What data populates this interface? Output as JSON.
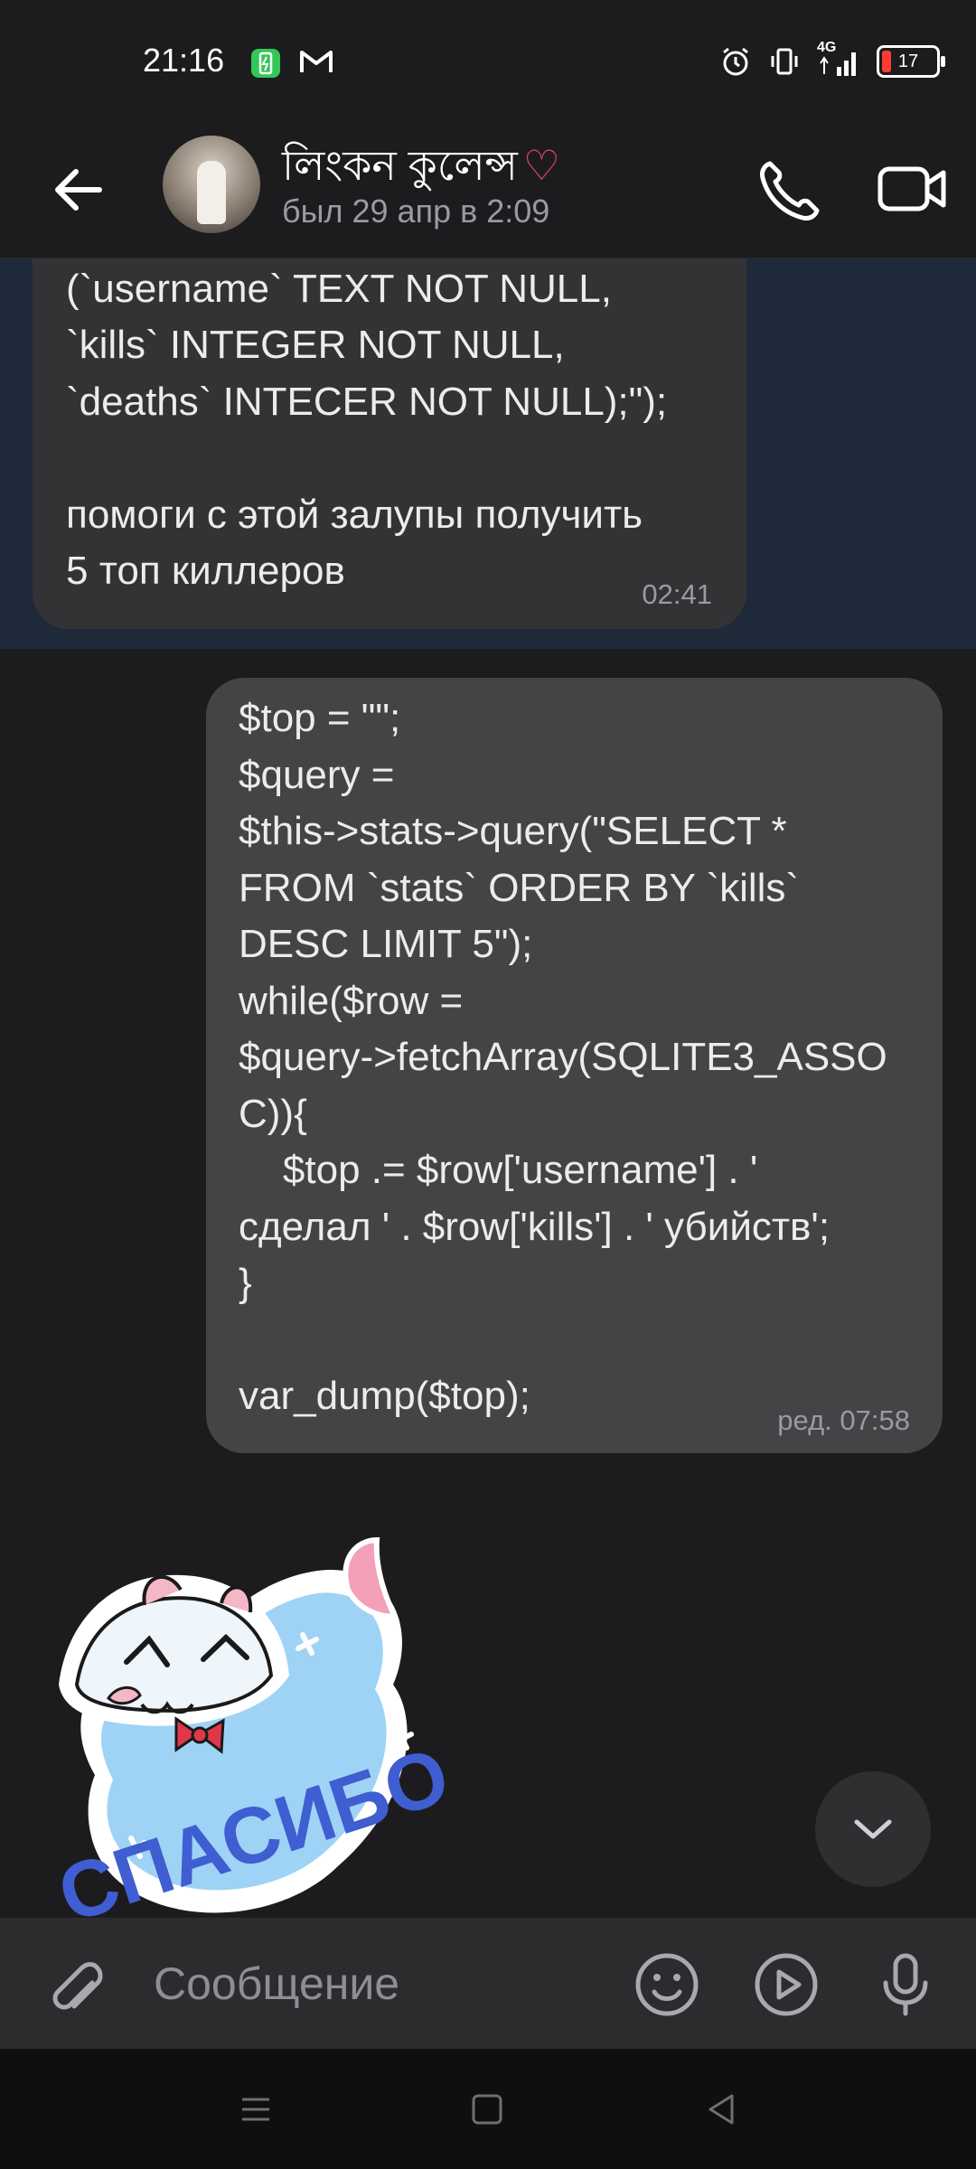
{
  "status_bar": {
    "time": "21:16",
    "network": "4G",
    "battery": "17"
  },
  "header": {
    "contact_name": "লিংকন কুলেন্স",
    "contact_name_emoji": "♡",
    "last_seen": "был 29 апр в 2:09"
  },
  "messages": [
    {
      "direction": "incoming",
      "text": "TABLE IF NOT EXISTS `stats`\n(`username` TEXT NOT NULL,\n`kills` INTEGER NOT NULL,\n`deaths` INTECER NOT NULL);\");\n\nпомоги с этой залупы получить\n5 топ киллеров",
      "time": "02:41"
    },
    {
      "direction": "outgoing",
      "text": "$top = \"\";\n$query =\n$this->stats->query(\"SELECT *\nFROM `stats` ORDER BY `kills`\nDESC LIMIT 5\");\nwhile($row =\n$query->fetchArray(SQLITE3_ASSO\nC)){\n    $top .= $row['username'] . '\nсделал ' . $row['kills'] . ' убийств';\n}\n\nvar_dump($top);",
      "time": "ред. 07:58"
    },
    {
      "direction": "incoming",
      "type": "sticker",
      "sticker_text": "СПАСИБО"
    }
  ],
  "input": {
    "placeholder": "Сообщение"
  },
  "icons": {
    "back": "arrow-left-icon",
    "call": "phone-icon",
    "video": "video-camera-icon",
    "attach": "paperclip-icon",
    "emoji": "smiley-icon",
    "video_message": "play-circle-icon",
    "voice": "microphone-icon",
    "scroll_down": "chevron-down-icon"
  },
  "colors": {
    "background": "#1c1c1e",
    "incoming_bubble": "#333335",
    "outgoing_bubble": "#444446",
    "highlight": "#1e2a3a",
    "sticker_heart": "#9fd3f5",
    "sticker_text": "#3f5ed1"
  }
}
